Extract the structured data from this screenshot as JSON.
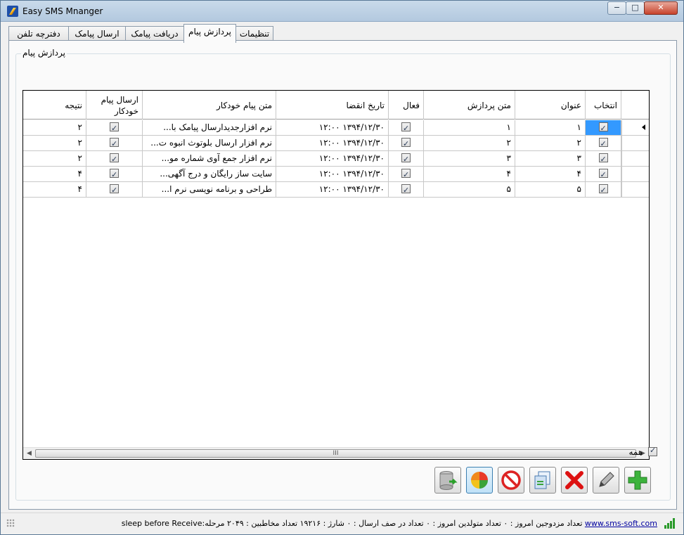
{
  "window": {
    "title": "Easy SMS Mnanger",
    "min": "−",
    "max": "□",
    "close": "✕"
  },
  "tabs": [
    {
      "label": "تنظیمات"
    },
    {
      "label": "پردازش پیام"
    },
    {
      "label": "دریافت پیامک"
    },
    {
      "label": "ارسال پیامک"
    },
    {
      "label": "دفترچه تلفن"
    }
  ],
  "group": {
    "label": "پردازش پیام"
  },
  "grid": {
    "columns": [
      "انتخاب",
      "عنوان",
      "متن پردازش",
      "فعال",
      "تاریخ انقضا",
      "متن پیام خودکار",
      "ارسال پیام خودکار",
      "نتیجه"
    ],
    "rows": [
      {
        "select": true,
        "title": "۱",
        "processing_text": "۱",
        "active": true,
        "expire": "۱۳۹۴/۱۲/۳۰ ۱۲:۰۰",
        "auto_text": "نرم افزارجدیدارسال پیامک با...",
        "auto_send": true,
        "result": "۲"
      },
      {
        "select": true,
        "title": "۲",
        "processing_text": "۲",
        "active": true,
        "expire": "۱۳۹۴/۱۲/۳۰ ۱۲:۰۰",
        "auto_text": "نرم افزار ارسال بلوتوث انبوه ت...",
        "auto_send": true,
        "result": "۲"
      },
      {
        "select": true,
        "title": "۳",
        "processing_text": "۳",
        "active": true,
        "expire": "۱۳۹۴/۱۲/۳۰ ۱۲:۰۰",
        "auto_text": "نرم افزار جمع آوی شماره مو...",
        "auto_send": true,
        "result": "۲"
      },
      {
        "select": true,
        "title": "۴",
        "processing_text": "۴",
        "active": true,
        "expire": "۱۳۹۴/۱۲/۳۰ ۱۲:۰۰",
        "auto_text": "سایت ساز رایگان و درج آگهی...",
        "auto_send": true,
        "result": "۴"
      },
      {
        "select": true,
        "title": "۵",
        "processing_text": "۵",
        "active": true,
        "expire": "۱۳۹۴/۱۲/۳۰ ۱۲:۰۰",
        "auto_text": "طراحی و برنامه نویسی نرم ا...",
        "auto_send": true,
        "result": "۴"
      }
    ],
    "scroll_thumb_glyph": "III"
  },
  "all_checkbox": {
    "label": "همه",
    "checked": true
  },
  "toolbar": {
    "buttons": [
      {
        "icon": "database-import-icon"
      },
      {
        "icon": "pie-chart-icon"
      },
      {
        "icon": "stop-icon"
      },
      {
        "icon": "copy-icon"
      },
      {
        "icon": "delete-icon"
      },
      {
        "icon": "edit-icon"
      },
      {
        "icon": "add-icon"
      }
    ]
  },
  "status": {
    "website": "www.sms-soft.com",
    "text": "تعداد مزدوجین امروز : ۰  تعداد متولدین امروز : ۰  تعداد در صف ارسال : ۰  شارژ : ۱۹۲۱۶  تعداد مخاطبین : ۲۰۴۹  مرحله:sleep before Receive"
  },
  "colors": {
    "selected_cell": "#3399ff",
    "link": "#00009f"
  }
}
